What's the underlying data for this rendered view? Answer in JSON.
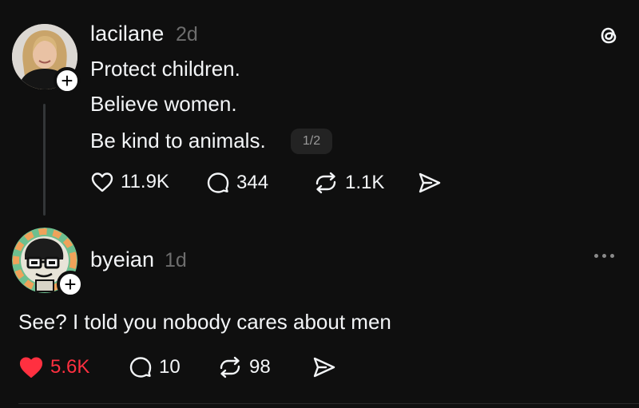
{
  "post": {
    "username": "lacilane",
    "time": "2d",
    "lines": [
      "Protect children.",
      "Believe women.",
      "Be kind to animals."
    ],
    "page_indicator": "1/2",
    "likes": "11.9K",
    "comments": "344",
    "reposts": "1.1K"
  },
  "reply": {
    "username": "byeian",
    "time": "1d",
    "text": "See? I told you nobody cares about men",
    "likes": "5.6K",
    "comments": "10",
    "reposts": "98"
  },
  "colors": {
    "background": "#0f0f0f",
    "liked": "#ff3040",
    "muted": "#6d6d6d"
  },
  "icons": [
    "threads-logo-icon",
    "heart-icon",
    "comment-icon",
    "repost-icon",
    "share-icon",
    "plus-icon",
    "more-icon"
  ]
}
